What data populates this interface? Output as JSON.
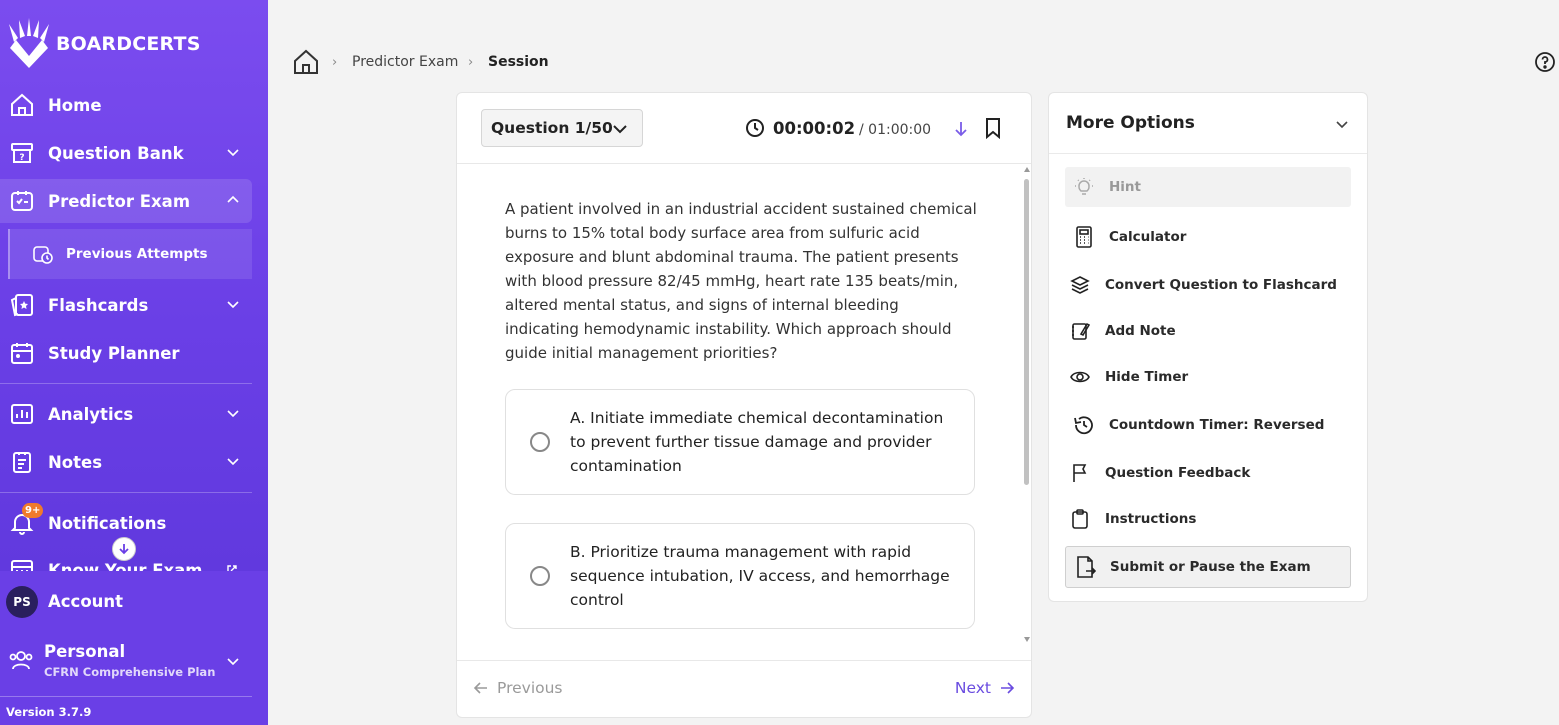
{
  "brand": {
    "name": "BOARDCERTS"
  },
  "sidebar": {
    "items": [
      {
        "label": "Home",
        "icon": "home-icon"
      },
      {
        "label": "Question Bank",
        "icon": "question-bank-icon"
      },
      {
        "label": "Predictor Exam",
        "icon": "predictor-exam-icon"
      },
      {
        "label": "Flashcards",
        "icon": "flashcards-icon"
      },
      {
        "label": "Study Planner",
        "icon": "calendar-icon"
      },
      {
        "label": "Analytics",
        "icon": "analytics-icon"
      },
      {
        "label": "Notes",
        "icon": "notes-icon"
      },
      {
        "label": "Notifications",
        "icon": "bell-icon"
      },
      {
        "label": "Know Your Exam",
        "icon": "know-exam-icon"
      }
    ],
    "sub_item": {
      "label": "Previous Attempts",
      "icon": "previous-attempts-icon"
    },
    "notification_badge": "9+",
    "account": {
      "initials": "PS",
      "label": "Account"
    },
    "plan": {
      "name": "Personal",
      "detail": "CFRN Comprehensive Plan"
    },
    "version": "Version 3.7.9"
  },
  "breadcrumb": {
    "items": [
      "Predictor Exam",
      "Session"
    ]
  },
  "question": {
    "selector_label": "Question 1/50",
    "timer_elapsed": "00:00:02",
    "timer_total": "/ 01:00:00",
    "text": "A patient involved in an industrial accident sustained chemical burns to 15% total body surface area from sulfuric acid exposure and blunt abdominal trauma. The patient presents with blood pressure 82/45 mmHg, heart rate 135 beats/min, altered mental status, and signs of internal bleeding indicating hemodynamic instability. Which approach should guide initial management priorities?",
    "options": [
      {
        "text": "A. Initiate immediate chemical decontamination to prevent further tissue damage and provider contamination"
      },
      {
        "text": "B. Prioritize trauma management with rapid sequence intubation, IV access, and hemorrhage control"
      }
    ],
    "prev_label": "Previous",
    "next_label": "Next"
  },
  "more_options": {
    "title": "More Options",
    "items": [
      {
        "label": "Hint",
        "icon": "lightbulb-icon"
      },
      {
        "label": "Calculator",
        "icon": "calculator-icon"
      },
      {
        "label": "Convert Question to Flashcard",
        "icon": "layers-icon"
      },
      {
        "label": "Add Note",
        "icon": "note-edit-icon"
      },
      {
        "label": "Hide Timer",
        "icon": "eye-icon"
      },
      {
        "label": "Countdown Timer: Reversed",
        "icon": "history-icon"
      },
      {
        "label": "Question Feedback",
        "icon": "flag-icon"
      },
      {
        "label": "Instructions",
        "icon": "clipboard-icon"
      },
      {
        "label": "Submit or Pause the Exam",
        "icon": "file-export-icon"
      }
    ]
  },
  "colors": {
    "sidebar_start": "#7b4cef",
    "sidebar_end": "#5b35d9",
    "accent": "#6a4ce0",
    "badge": "#f07a2b"
  }
}
